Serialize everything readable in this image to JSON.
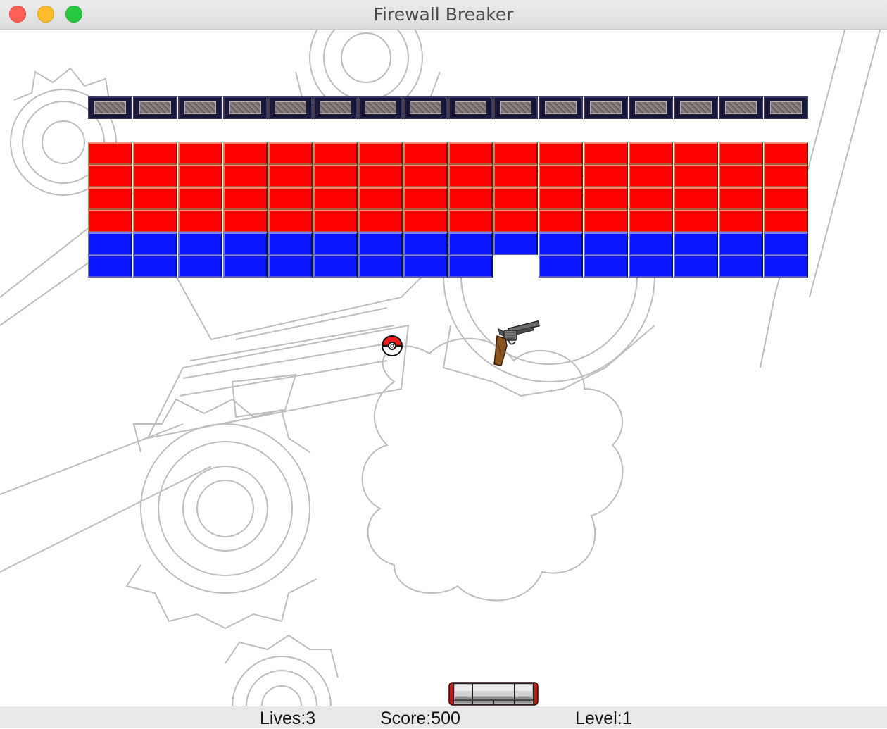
{
  "window": {
    "title": "Firewall Breaker"
  },
  "status": {
    "lives_label": "Lives:3",
    "score_label": "Score:500",
    "level_label": "Level:1",
    "lives": 3,
    "score": 500,
    "level": 1
  },
  "bricks": {
    "columns": 16,
    "rows": [
      {
        "type": "steel",
        "present": [
          1,
          1,
          1,
          1,
          1,
          1,
          1,
          1,
          1,
          1,
          1,
          1,
          1,
          1,
          1,
          1
        ]
      },
      {
        "type": "red",
        "present": [
          1,
          1,
          1,
          1,
          1,
          1,
          1,
          1,
          1,
          1,
          1,
          1,
          1,
          1,
          1,
          1
        ]
      },
      {
        "type": "red",
        "present": [
          1,
          1,
          1,
          1,
          1,
          1,
          1,
          1,
          1,
          1,
          1,
          1,
          1,
          1,
          1,
          1
        ]
      },
      {
        "type": "red",
        "present": [
          1,
          1,
          1,
          1,
          1,
          1,
          1,
          1,
          1,
          1,
          1,
          1,
          1,
          1,
          1,
          1
        ]
      },
      {
        "type": "red",
        "present": [
          1,
          1,
          1,
          1,
          1,
          1,
          1,
          1,
          1,
          1,
          1,
          1,
          1,
          1,
          1,
          1
        ]
      },
      {
        "type": "blue",
        "present": [
          1,
          1,
          1,
          1,
          1,
          1,
          1,
          1,
          1,
          1,
          1,
          1,
          1,
          1,
          1,
          1
        ]
      },
      {
        "type": "blue",
        "present": [
          1,
          1,
          1,
          1,
          1,
          1,
          1,
          1,
          1,
          0,
          1,
          1,
          1,
          1,
          1,
          1
        ]
      }
    ]
  },
  "colors": {
    "red_brick": "#ff0000",
    "blue_brick": "#0a14ff",
    "steel_brick": "#17173a"
  },
  "icons": {
    "ball": "pokeball-icon",
    "powerup": "revolver-icon",
    "paddle": "paddle-icon"
  }
}
